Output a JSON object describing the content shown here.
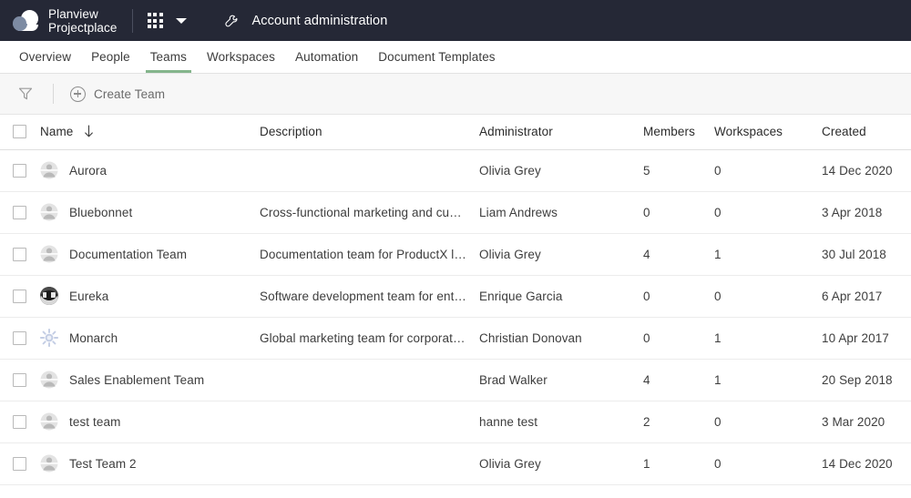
{
  "appbar": {
    "brand_line1": "Planview",
    "brand_line2": "Projectplace",
    "grid_icon": "app-grid-icon",
    "caret_icon": "chevron-down-icon",
    "wrench_icon": "wrench-icon",
    "admin_title": "Account administration",
    "bg_color": "#252836"
  },
  "tabs": {
    "active_color": "#84b58c",
    "items": [
      {
        "label": "Overview",
        "active": false
      },
      {
        "label": "People",
        "active": false
      },
      {
        "label": "Teams",
        "active": true
      },
      {
        "label": "Workspaces",
        "active": false
      },
      {
        "label": "Automation",
        "active": false
      },
      {
        "label": "Document Templates",
        "active": false
      }
    ]
  },
  "toolbar": {
    "filter_icon": "filter-funnel-icon",
    "create_icon": "plus-circle-icon",
    "create_label": "Create Team"
  },
  "table": {
    "sort_column": "Name",
    "sort_direction": "ascending",
    "sort_icon": "arrow-down-icon",
    "headers": {
      "name": "Name",
      "description": "Description",
      "administrator": "Administrator",
      "members": "Members",
      "workspaces": "Workspaces",
      "created": "Created"
    },
    "rows": [
      {
        "avatar": "default-team-avatar",
        "name": "Aurora",
        "description": "",
        "administrator": "Olivia Grey",
        "members": "5",
        "workspaces": "0",
        "created": "14 Dec 2020"
      },
      {
        "avatar": "default-team-avatar",
        "name": "Bluebonnet",
        "description": "Cross-functional marketing and cust...",
        "administrator": "Liam Andrews",
        "members": "0",
        "workspaces": "0",
        "created": "3 Apr 2018"
      },
      {
        "avatar": "default-team-avatar",
        "name": "Documentation Team",
        "description": "Documentation team for ProductX la...",
        "administrator": "Olivia Grey",
        "members": "4",
        "workspaces": "1",
        "created": "30 Jul 2018"
      },
      {
        "avatar": "dark-photo-avatar",
        "name": "Eureka",
        "description": "Software development team for ente...",
        "administrator": "Enrique Garcia",
        "members": "0",
        "workspaces": "0",
        "created": "6 Apr 2017"
      },
      {
        "avatar": "starburst-avatar",
        "name": "Monarch",
        "description": "Global marketing team for corporate ...",
        "administrator": "Christian Donovan",
        "members": "0",
        "workspaces": "1",
        "created": "10 Apr 2017"
      },
      {
        "avatar": "default-team-avatar",
        "name": "Sales Enablement Team",
        "description": "",
        "administrator": "Brad Walker",
        "members": "4",
        "workspaces": "1",
        "created": "20 Sep 2018"
      },
      {
        "avatar": "default-team-avatar",
        "name": "test team",
        "description": "",
        "administrator": "hanne test",
        "members": "2",
        "workspaces": "0",
        "created": "3 Mar 2020"
      },
      {
        "avatar": "default-team-avatar",
        "name": "Test Team 2",
        "description": "",
        "administrator": "Olivia Grey",
        "members": "1",
        "workspaces": "0",
        "created": "14 Dec 2020"
      }
    ]
  }
}
